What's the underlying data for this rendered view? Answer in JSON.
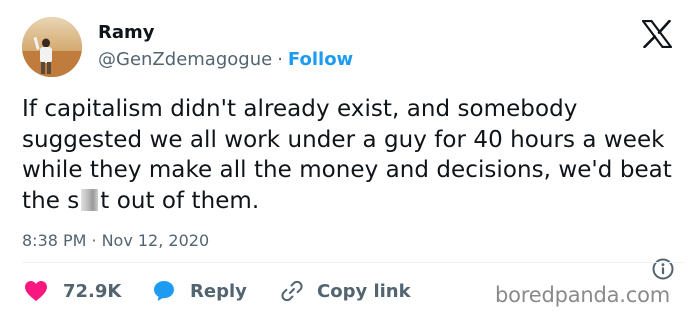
{
  "author": {
    "name": "Ramy",
    "handle": "@GenZdemagogue",
    "separator": "·",
    "follow_label": "Follow"
  },
  "brand_icon": "x-logo-icon",
  "tweet": {
    "text_before_censor": "If capitalism didn't already exist, and somebody suggested we all work under a guy for 40 hours a week while they make all the money and decisions, we'd beat the s",
    "text_after_censor": "t out of them."
  },
  "meta": {
    "time": "8:38 PM",
    "separator": "·",
    "date": "Nov 12, 2020"
  },
  "actions": {
    "likes": "72.9K",
    "reply": "Reply",
    "copy_link": "Copy link"
  },
  "watermark": "boredpanda.com",
  "colors": {
    "accent": "#1d9bf0",
    "like": "#f91880",
    "muted": "#536471",
    "text": "#0f1419"
  }
}
